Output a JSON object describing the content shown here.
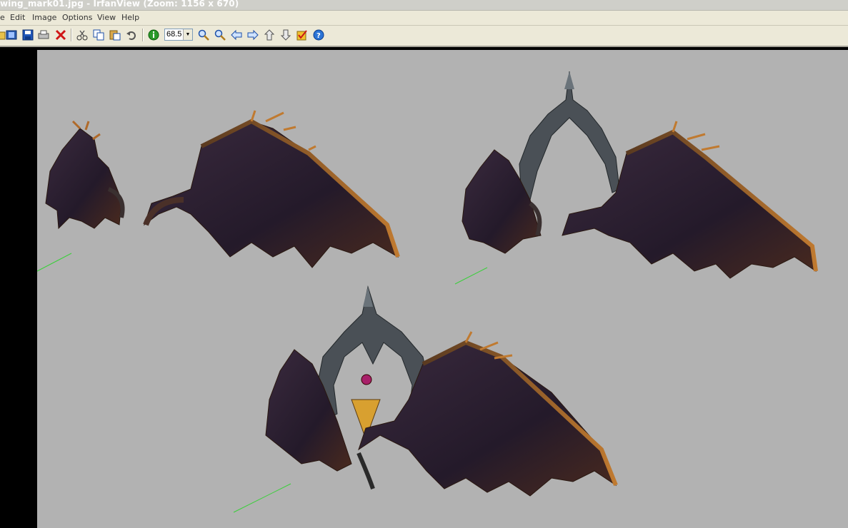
{
  "window": {
    "title": "wing_mark01.jpg - IrfanView (Zoom: 1156 x 670)"
  },
  "menu": [
    "e",
    "Edit",
    "Image",
    "Options",
    "View",
    "Help"
  ],
  "toolbar": {
    "icons": [
      "open-folder-icon",
      "slideshow-icon",
      "save-icon",
      "print-icon",
      "delete-icon",
      "cut-icon",
      "copy-icon",
      "paste-icon",
      "undo-icon",
      "info-icon",
      "zoom-in-icon",
      "zoom-out-icon",
      "previous-icon",
      "next-icon",
      "first-icon",
      "last-icon",
      "options-icon",
      "help-icon"
    ],
    "zoom_value": "68.5"
  },
  "image": {
    "description_icons": [
      "wing-sprite-left-small",
      "wing-sprite-right",
      "wing-sprite-with-crest",
      "wing-sprite-full-emblem"
    ]
  }
}
